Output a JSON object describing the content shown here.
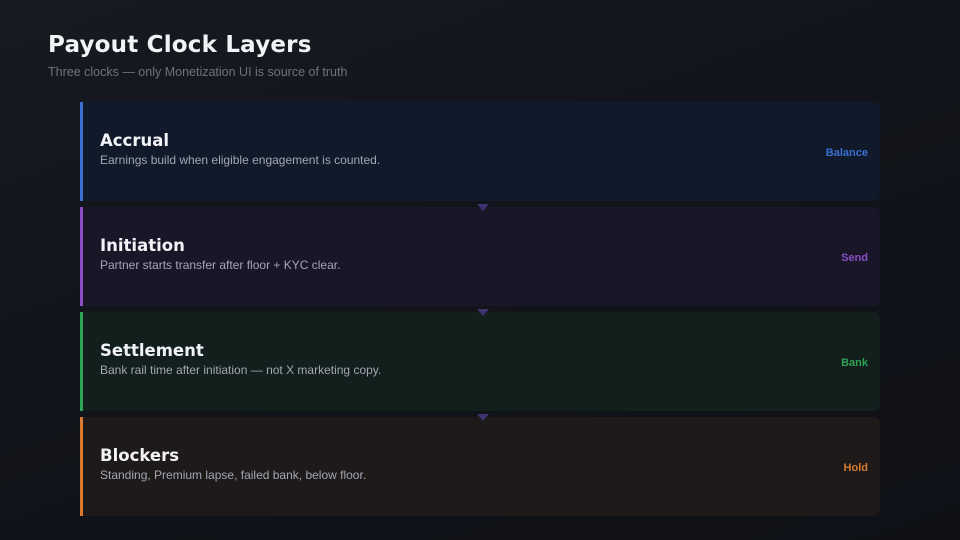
{
  "header": {
    "title": "Payout Clock Layers",
    "subtitle": "Three clocks — only Monetization UI is source of truth"
  },
  "colors": {
    "accrual": "#3b6fd4",
    "initiation": "#8a4fc4",
    "settlement": "#2ea356",
    "blockers": "#d87a30",
    "connector": "#3c3470"
  },
  "layers": [
    {
      "title": "Accrual",
      "description": "Earnings build when eligible engagement is counted.",
      "tag": "Balance"
    },
    {
      "title": "Initiation",
      "description": "Partner starts transfer after floor + KYC clear.",
      "tag": "Send"
    },
    {
      "title": "Settlement",
      "description": "Bank rail time after initiation — not X marketing copy.",
      "tag": "Bank"
    },
    {
      "title": "Blockers",
      "description": "Standing, Premium lapse, failed bank, below floor.",
      "tag": "Hold"
    }
  ]
}
